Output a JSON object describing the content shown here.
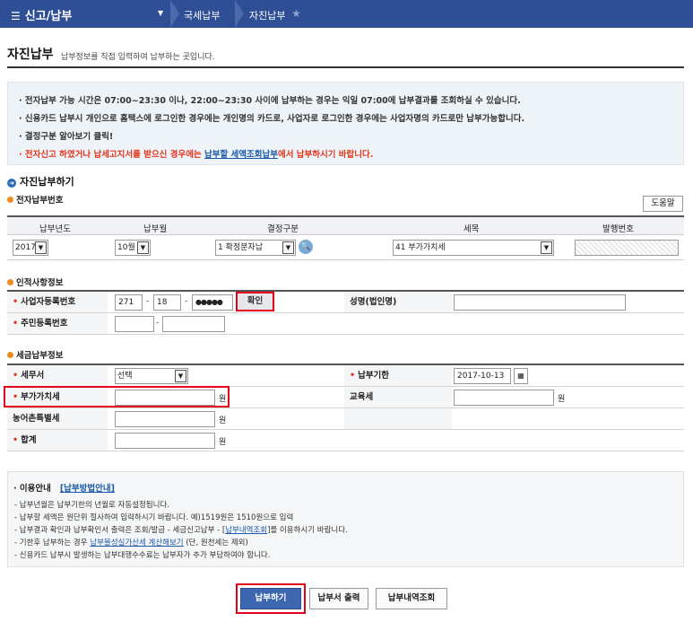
{
  "topbar": {
    "menu_label": "신고/납부",
    "breadcrumb": [
      "국세납부",
      "자진납부"
    ]
  },
  "page": {
    "title": "자진납부",
    "description": "납부정보를 직접 입력하여 납부하는 곳입니다."
  },
  "notice": {
    "line1": "· 전자납부 가능 시간은 07:00~23:30 이나, 22:00~23:30 사이에 납부하는 경우는 익일 07:00에 납부결과를 조회하실 수 있습니다.",
    "line2": "· 신용카드 납부시 개인으로 홈택스에 로그인한 경우에는 개인명의 카드로, 사업자로 로그인한 경우에는 사업자명의 카드로만 납부가능합니다.",
    "line3": "· 결정구분 알아보기 클릭!",
    "line4_pre": "· 전자신고 하였거나 납세고지서를 받으신 경우에는 ",
    "line4_link": "납부할 세액조회납부",
    "line4_post": "에서 납부하시기 바랍니다."
  },
  "section": {
    "title": "자진납부하기",
    "sub_number": "전자납부번호",
    "sub_identity": "인적사항정보",
    "sub_tax": "세금납부정보",
    "help_button": "도움말"
  },
  "number_grid": {
    "headers": [
      "납부년도",
      "납부월",
      "결정구분",
      "세목",
      "발행번호"
    ],
    "year": "2017",
    "month": "10월",
    "decision": "1 확정분자납",
    "tax_item": "41 부가가치세",
    "serial": ""
  },
  "identity": {
    "biz_no_label": "사업자등록번호",
    "biz_no_1": "271",
    "biz_no_2": "18",
    "biz_no_3": "●●●●●",
    "confirm_button": "확인",
    "name_label": "성명(법인명)",
    "name_value": "",
    "resident_label": "주민등록번호",
    "resident_1": "",
    "resident_2": ""
  },
  "tax": {
    "office_label": "세무서",
    "office_value": "선택",
    "due_label": "납부기한",
    "due_value": "2017-10-13",
    "vat_label": "부가가치세",
    "vat_value": "",
    "edu_label": "교육세",
    "edu_value": "",
    "rural_label": "농어촌특별세",
    "rural_value": "",
    "total_label": "합계",
    "total_value": "",
    "unit": "원"
  },
  "guide": {
    "title": "· 이용안내",
    "link": "[납부방법안내]",
    "item1": "- 납부년월은 납부기한의 년월로 자동설정됩니다.",
    "item2": "- 납부할 세액은 원단위 절사하여 입력하시기 바랍니다. 예)1519원은 1510원으로 입력",
    "item3_pre": "- 납부결과 확인과 납부확인서 출력은 조회/발급 - 세금신고납부 - [",
    "item3_link": "납부내역조회",
    "item3_post": "]를 이용하시기 바랍니다.",
    "item4_pre": "- 기한후 납부하는 경우 ",
    "item4_link": "납부불성실가산세 계산해보기",
    "item4_post": " (단, 원천세는 제외)",
    "item5": "- 신용카드 납부시 발생하는 납부대행수수료는 납부자가 추가 부담하여야 합니다."
  },
  "actions": {
    "pay": "납부하기",
    "print": "납부서 출력",
    "history": "납부내역조회"
  }
}
